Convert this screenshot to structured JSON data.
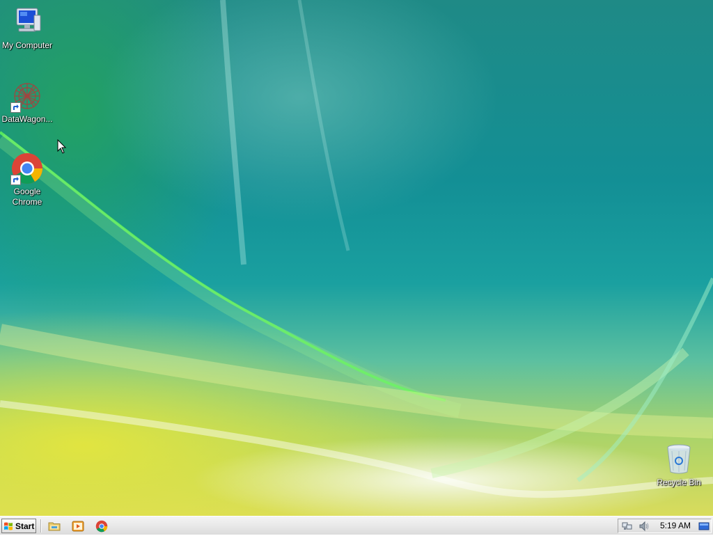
{
  "desktop": {
    "icons": [
      {
        "label": "My Computer",
        "icon": "my-computer-icon"
      },
      {
        "label": "DataWagon...",
        "icon": "datawagon-icon"
      },
      {
        "label": "Google Chrome",
        "icon": "chrome-icon"
      },
      {
        "label": "Recycle Bin",
        "icon": "recycle-bin-icon"
      }
    ]
  },
  "taskbar": {
    "start_label": "Start",
    "quick_launch": [
      {
        "icon": "file-explorer-icon"
      },
      {
        "icon": "media-player-icon"
      },
      {
        "icon": "chrome-icon"
      }
    ],
    "tray": {
      "icons": [
        "network-icon",
        "volume-icon",
        "show-desktop-icon"
      ],
      "clock": "5:19 AM"
    }
  },
  "colors": {
    "taskbar_bg": "#e9e9e9",
    "wallpaper_teal": "#1aa0a0",
    "wallpaper_yellow": "#d9dc5c"
  }
}
